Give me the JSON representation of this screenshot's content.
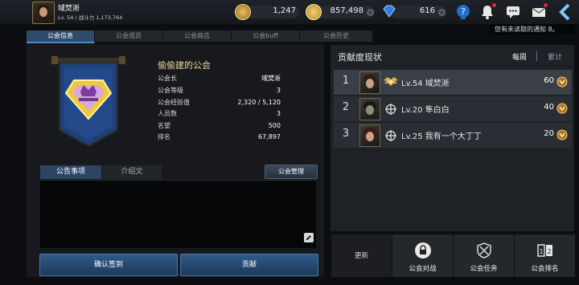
{
  "player": {
    "name": "域焚淅",
    "level_power": "Lv. 54 / 战斗力 1,173,764"
  },
  "resources": [
    {
      "name": "gold-coin",
      "value": "1,247"
    },
    {
      "name": "silver-coin",
      "value": "857,498"
    },
    {
      "name": "diamond",
      "value": "616"
    }
  ],
  "notice_banner": "您有未读取的通知 8。",
  "tabs": [
    "公会信息",
    "公会成员",
    "公会商店",
    "公会buff",
    "公会历史"
  ],
  "guild": {
    "name": "偷偷建的公会",
    "rows": [
      {
        "k": "公会长",
        "v": "域焚淅"
      },
      {
        "k": "公会等级",
        "v": "3"
      },
      {
        "k": "公会经验值",
        "v": "2,320 / 5,120"
      },
      {
        "k": "人员数",
        "v": "3"
      },
      {
        "k": "名望",
        "v": "500"
      },
      {
        "k": "排名",
        "v": "67,897"
      }
    ]
  },
  "subtabs": [
    "公告事项",
    "介绍文"
  ],
  "manage_label": "公会管理",
  "buttons": {
    "checkin": "确认签到",
    "donate": "贡献"
  },
  "contribution": {
    "title": "贡献度现状",
    "tab_weekly": "每周",
    "tab_total": "累计",
    "ranks": [
      {
        "rank": "1",
        "name": "Lv.54 域焚淅",
        "score": "60"
      },
      {
        "rank": "2",
        "name": "Lv.20 隼白白",
        "score": "40"
      },
      {
        "rank": "3",
        "name": "Lv.25 我有一个大丁丁",
        "score": "20"
      }
    ]
  },
  "bottom": {
    "update": "更新",
    "battle": "公会对战",
    "mission": "公会任务",
    "ranking": "公会排名"
  },
  "colors": {
    "accent": "#4a8ad4",
    "gold_text": "#f0d8a0",
    "active_tab": "#2f4b6b"
  }
}
